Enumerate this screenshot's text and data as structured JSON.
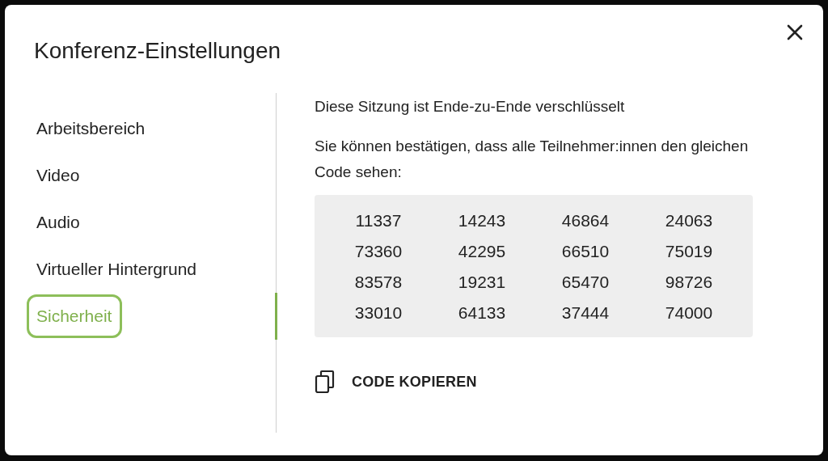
{
  "dialog": {
    "title": "Konferenz-Einstellungen"
  },
  "sidebar": {
    "items": [
      {
        "label": "Arbeitsbereich",
        "selected": false
      },
      {
        "label": "Video",
        "selected": false
      },
      {
        "label": "Audio",
        "selected": false
      },
      {
        "label": "Virtueller Hintergrund",
        "selected": false
      },
      {
        "label": "Sicherheit",
        "selected": true
      }
    ]
  },
  "content": {
    "heading": "Diese Sitzung ist Ende-zu-Ende verschlüsselt",
    "description": "Sie können bestätigen, dass alle Teilnehmer:innen den gleichen Code sehen:",
    "code": [
      "11337",
      "14243",
      "46864",
      "24063",
      "73360",
      "42295",
      "66510",
      "75019",
      "83578",
      "19231",
      "65470",
      "98726",
      "33010",
      "64133",
      "37444",
      "74000"
    ],
    "copy_button": "CODE KOPIEREN"
  }
}
